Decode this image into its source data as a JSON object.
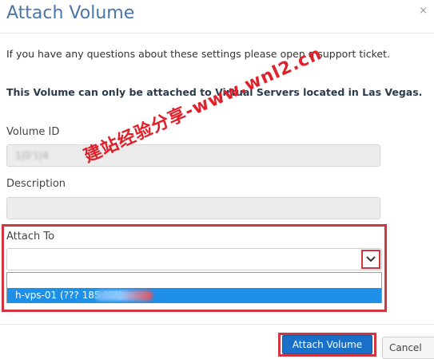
{
  "modal": {
    "title": "Attach Volume",
    "close_glyph": "×",
    "info_text": "If you have any questions about these settings please open a support ticket.",
    "notice_text": "This Volume can only be attached to Virtual Servers located in Las Vegas."
  },
  "fields": {
    "volume_id": {
      "label": "Volume ID",
      "value": "1|0'1|4"
    },
    "description": {
      "label": "Description",
      "value": ""
    },
    "attach_to": {
      "label": "Attach To",
      "selected": "",
      "options": [
        "",
        "h-vps-01 (??? 185 ???)"
      ]
    }
  },
  "buttons": {
    "attach_label": "Attach Volume",
    "cancel_label": "Cancel"
  },
  "watermark": {
    "text": "建站经验分享-www.wnl2.cn"
  },
  "colors": {
    "title": "#4a76a8",
    "primary_button": "#1a6fc8",
    "highlight": "#d03540",
    "option_selected": "#1e90e8"
  }
}
